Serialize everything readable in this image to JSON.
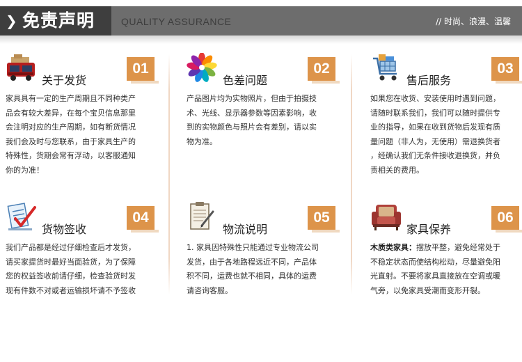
{
  "header": {
    "title": "免责声明",
    "subtitle": "QUALITY ASSURANCE",
    "slogan": "// 时尚、浪漫、温馨"
  },
  "panels": [
    {
      "number": "01",
      "title": "关于发货",
      "icon": "delivery-truck-icon",
      "lines": [
        "家具具有一定的生产周期且不同种类产",
        "品会有较大差异，在每个宝贝信息那里",
        "会注明对应的生产周期，如有断货情况",
        "我们会及时与您联系，由于家具生产的",
        "特殊性，货期会常有浮动，以客服通知",
        "你的为准！"
      ]
    },
    {
      "number": "02",
      "title": "色差问题",
      "icon": "color-palette-icon",
      "lines": [
        "产品图片均为实物照片，但由于拍摄技",
        "术、光线、显示器参数等因素影响，收",
        "到的实物颜色与照片会有差别，请以实",
        "物为准。"
      ]
    },
    {
      "number": "03",
      "title": "售后服务",
      "icon": "shopping-cart-icon",
      "lines": [
        "如果您在收货、安装使用时遇到问题，",
        "请随时联系我们，我们可以随时提供专",
        "业的指导，如果在收到货物后发现有质",
        "量问题（非人为，无使用）需退换货者",
        "，经确认我们无条件接收退换货，并负",
        "责相关的费用。"
      ]
    },
    {
      "number": "04",
      "title": "货物签收",
      "icon": "checklist-icon",
      "lines": [
        "我们产品都是经过仔细检查后才发货，",
        "请买家提货时最好当面验货，为了保障",
        "您的权益签收前请仔细，检查验货时发",
        "现有件数不对或者运输损坏请不予签收"
      ]
    },
    {
      "number": "05",
      "title": "物流说明",
      "icon": "clipboard-icon",
      "lines": [
        "1. 家具因特殊性只能通过专业物流公司",
        "发货，由于各地路程远近不同，产品体",
        "积不同，运费也就不相同，具体的运费",
        "请咨询客服。"
      ]
    },
    {
      "number": "06",
      "title": "家具保养",
      "icon": "armchair-icon",
      "lead": "木质类家具：",
      "lines": [
        "摆放平整，避免经常处于",
        "不稳定状态而使结构松动，尽量避免阳",
        "光直射。不要将家具直接放在空调或暖",
        "气旁，以免家具受潮而变形开裂。"
      ]
    }
  ]
}
